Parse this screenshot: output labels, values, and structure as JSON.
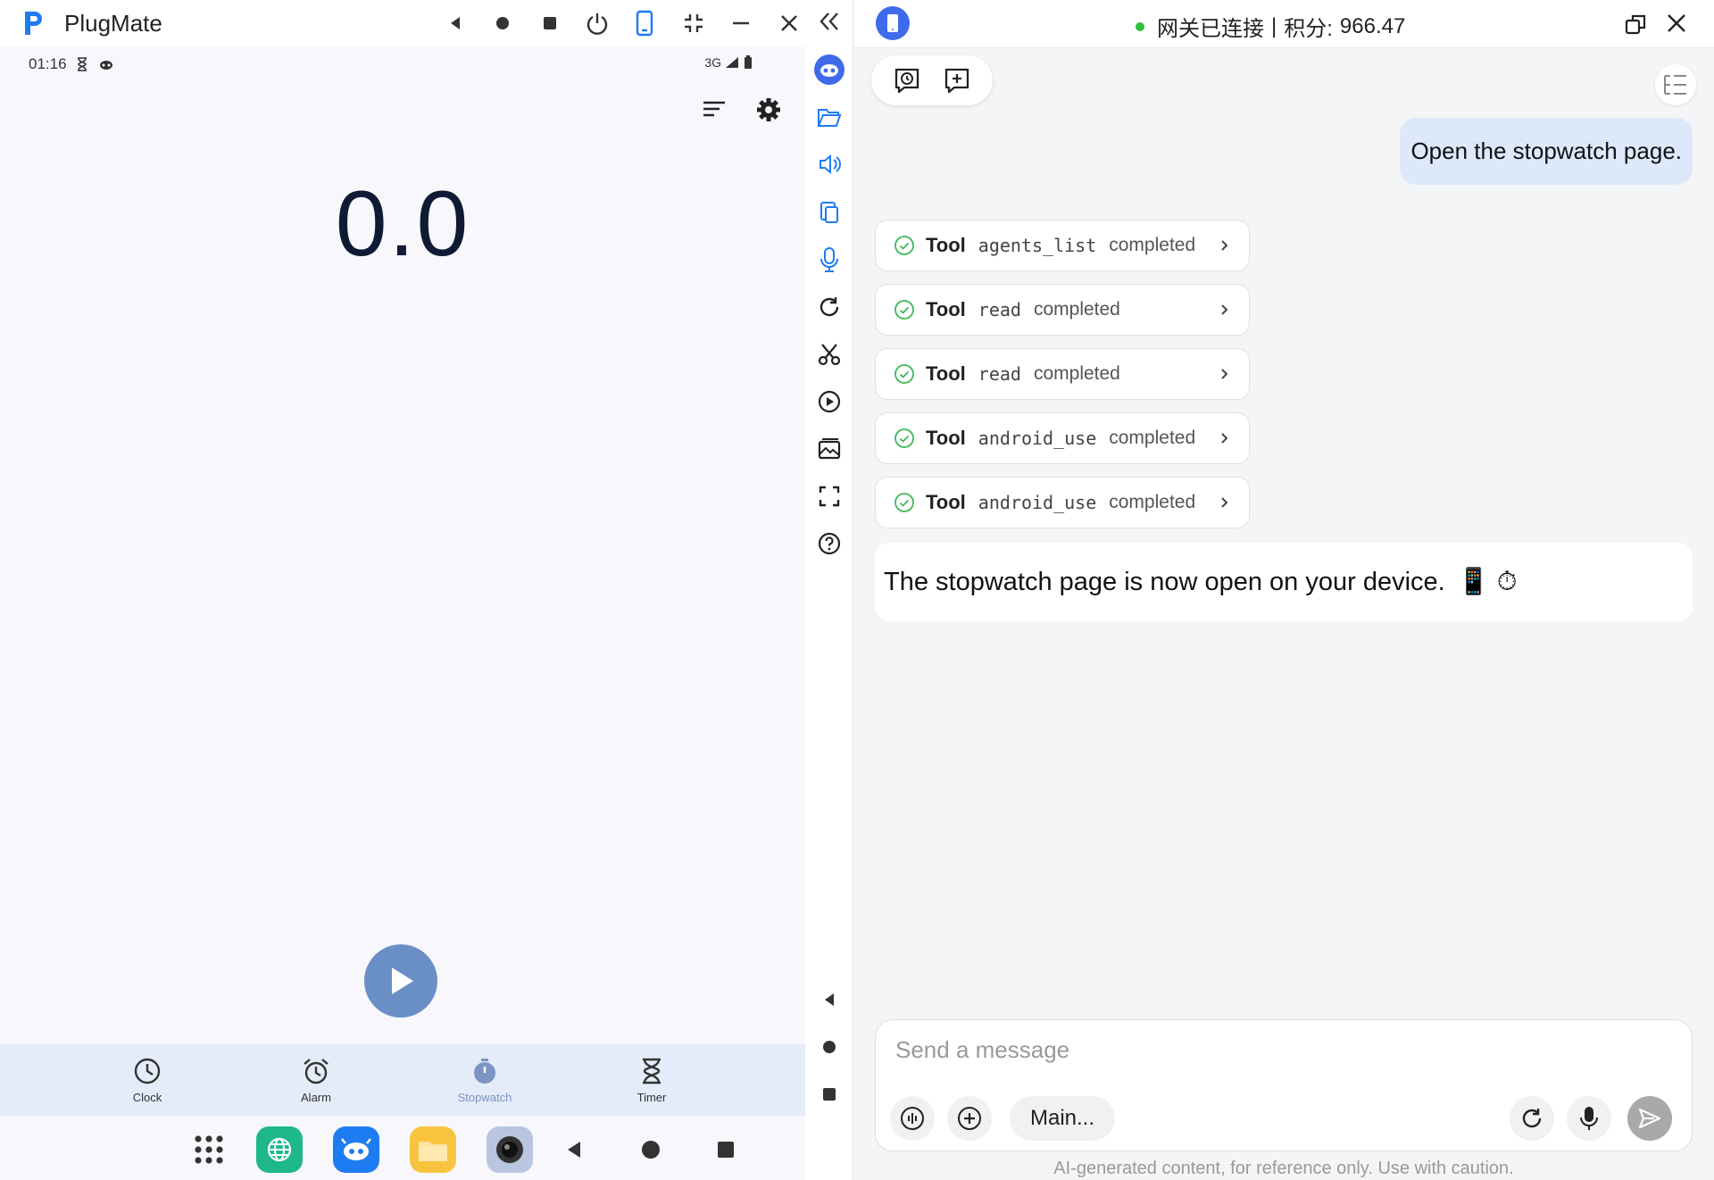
{
  "window": {
    "title": "PlugMate"
  },
  "phone": {
    "status": {
      "time": "01:16",
      "network": "3G"
    },
    "stopwatch_value": "0.0",
    "tabs": [
      {
        "label": "Clock",
        "icon": "clock-icon"
      },
      {
        "label": "Alarm",
        "icon": "alarm-icon"
      },
      {
        "label": "Stopwatch",
        "icon": "stopwatch-icon",
        "active": true
      },
      {
        "label": "Timer",
        "icon": "hourglass-icon"
      }
    ]
  },
  "chat": {
    "gateway_status": "网关已连接",
    "points_label": "积分:",
    "points_value": "966.47",
    "user_message": "Open the stopwatch page.",
    "tools": [
      {
        "word": "Tool",
        "name": "agents_list",
        "status": "completed"
      },
      {
        "word": "Tool",
        "name": "read",
        "status": "completed"
      },
      {
        "word": "Tool",
        "name": "read",
        "status": "completed"
      },
      {
        "word": "Tool",
        "name": "android_use",
        "status": "completed"
      },
      {
        "word": "Tool",
        "name": "android_use",
        "status": "completed"
      }
    ],
    "assistant_message": "The stopwatch page is now open on your device.",
    "assistant_emoji": "📱 ⏱",
    "composer": {
      "placeholder": "Send a message",
      "mode_label": "Main..."
    },
    "disclaimer": "AI-generated content, for reference only. Use with caution."
  },
  "colors": {
    "accent": "#1e7cf2",
    "play_button": "#6a8fc7",
    "tab_bar": "#e3ecf8",
    "user_bubble": "#dde8fb",
    "connected_dot": "#2fbf3b"
  }
}
